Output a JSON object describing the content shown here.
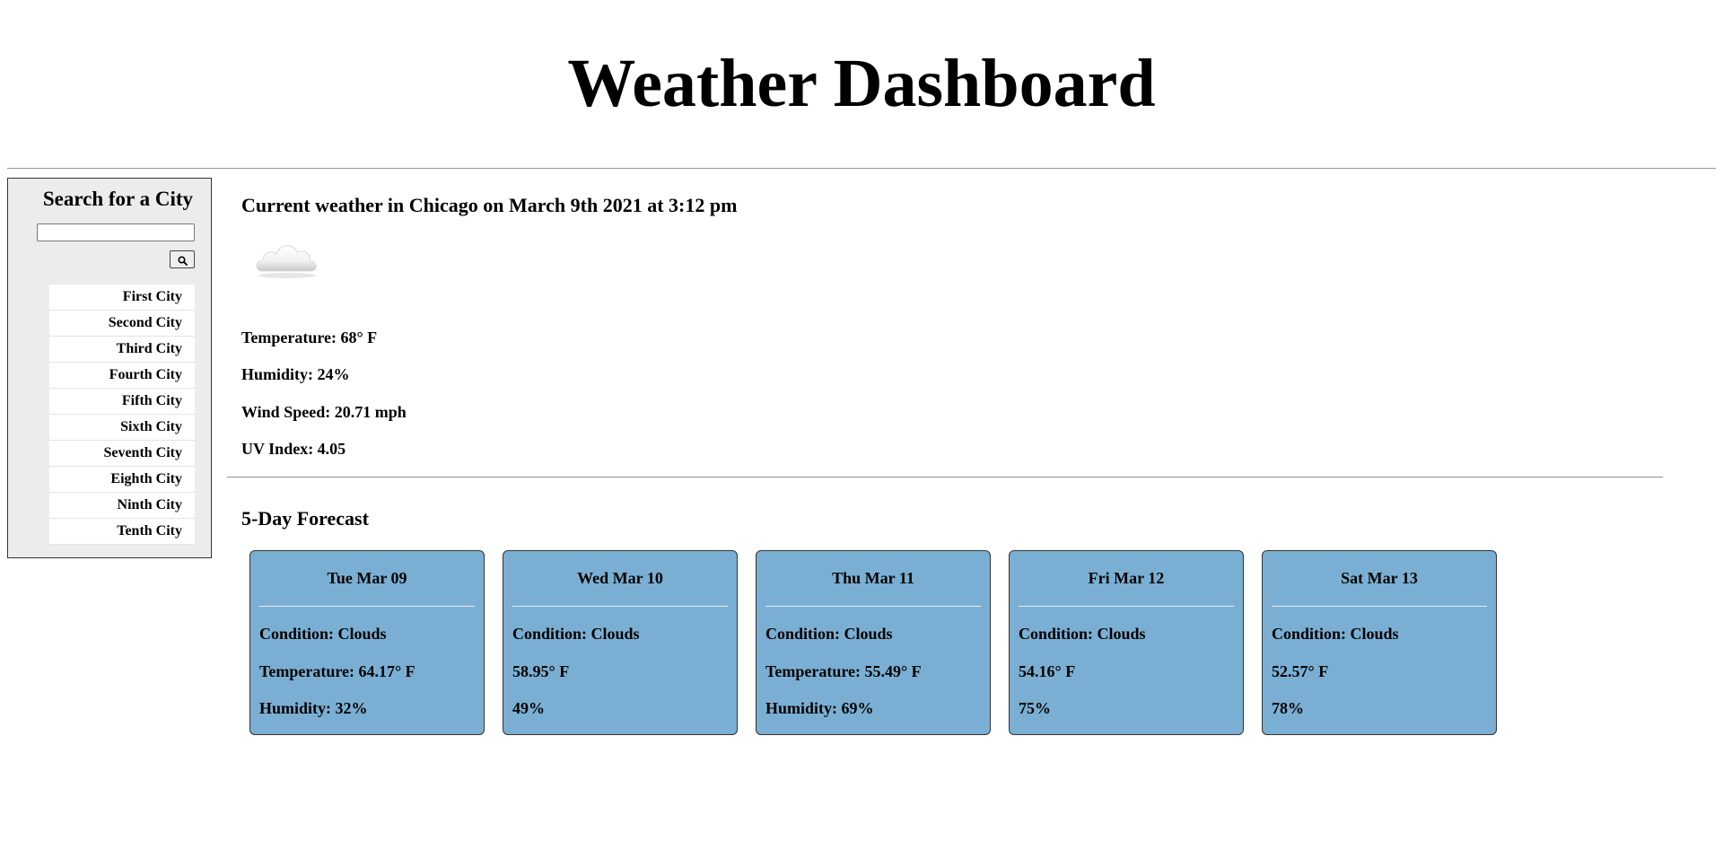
{
  "header": {
    "title": "Weather Dashboard"
  },
  "sidebar": {
    "title": "Search for a City",
    "search": {
      "value": "",
      "placeholder": ""
    },
    "search_button_icon": "search-icon",
    "cities": [
      "First City",
      "Second City",
      "Third City",
      "Fourth City",
      "Fifth City",
      "Sixth City",
      "Seventh City",
      "Eighth City",
      "Ninth City",
      "Tenth City"
    ]
  },
  "current": {
    "heading": "Current weather in Chicago on March 9th 2021 at 3:12 pm",
    "icon": "clouds-icon",
    "temperature": "Temperature: 68° F",
    "humidity": "Humidity: 24%",
    "wind_speed": "Wind Speed: 20.71 mph",
    "uv_index": "UV Index: 4.05"
  },
  "forecast": {
    "heading": "5-Day Forecast",
    "card_color": "#7aafd3",
    "days": [
      {
        "date": "Tue Mar 09",
        "condition": "Condition: Clouds",
        "temperature": "Temperature: 64.17° F",
        "humidity": "Humidity: 32%"
      },
      {
        "date": "Wed Mar 10",
        "condition": "Condition: Clouds",
        "temperature": "58.95° F",
        "humidity": "49%"
      },
      {
        "date": "Thu Mar 11",
        "condition": "Condition: Clouds",
        "temperature": "Temperature: 55.49° F",
        "humidity": "Humidity: 69%"
      },
      {
        "date": "Fri Mar 12",
        "condition": "Condition: Clouds",
        "temperature": "54.16° F",
        "humidity": "75%"
      },
      {
        "date": "Sat Mar 13",
        "condition": "Condition: Clouds",
        "temperature": "52.57° F",
        "humidity": "78%"
      }
    ]
  }
}
